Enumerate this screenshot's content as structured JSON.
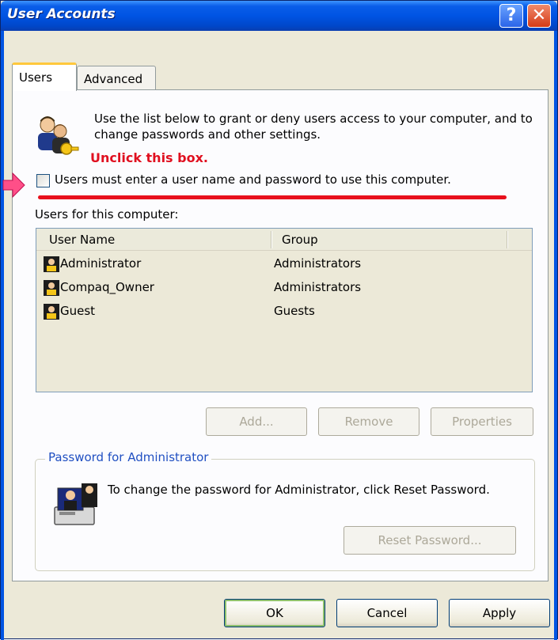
{
  "window": {
    "title": "User Accounts",
    "help_glyph": "?",
    "close_glyph": "✕"
  },
  "tabs": [
    {
      "label": "Users",
      "selected": true
    },
    {
      "label": "Advanced",
      "selected": false
    }
  ],
  "users_tab": {
    "intro_text": "Use the list below to grant or deny users access to your computer, and to change passwords and other settings.",
    "annotation": "Unclick this box.",
    "checkbox_label": "Users must enter a user name and password to use this computer.",
    "checkbox_checked": false,
    "users_label": "Users for this computer:",
    "columns": {
      "name": "User Name",
      "group": "Group"
    },
    "users": [
      {
        "name": "Administrator",
        "group": "Administrators"
      },
      {
        "name": "Compaq_Owner",
        "group": "Administrators"
      },
      {
        "name": "Guest",
        "group": "Guests"
      }
    ],
    "buttons": {
      "add": "Add...",
      "remove": "Remove",
      "properties": "Properties"
    },
    "password_group": {
      "title": "Password for Administrator",
      "text": "To change the password for Administrator, click Reset Password.",
      "reset_button": "Reset Password..."
    }
  },
  "footer": {
    "ok": "OK",
    "cancel": "Cancel",
    "apply": "Apply"
  },
  "colors": {
    "titlebar": "#0054e3",
    "annotation_red": "#e01020",
    "dialog_bg": "#ece9d8"
  }
}
